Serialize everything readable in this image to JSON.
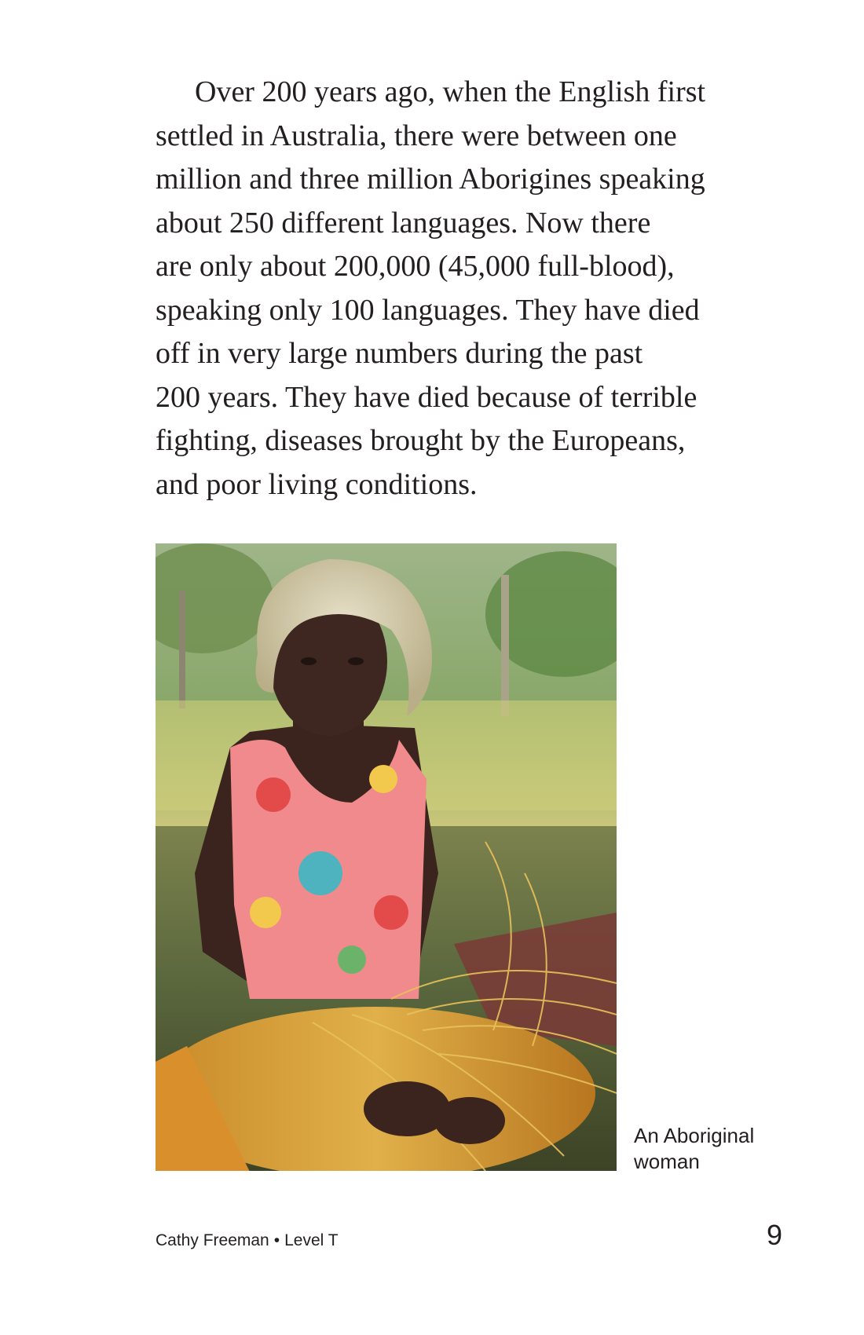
{
  "body_text": {
    "lines": [
      "Over 200 years ago, when the English first",
      "settled in Australia, there were between one",
      "million and three million Aborigines speaking",
      "about 250 different languages. Now there",
      "are only about 200,000 (45,000 full-blood),",
      "speaking only 100 languages. They have died",
      "off in very large numbers during the past",
      "200 years. They have died because of terrible",
      "fighting, diseases brought by the Europeans,",
      "and poor living conditions."
    ]
  },
  "photo": {
    "caption_lines": [
      "An Aboriginal",
      "woman"
    ]
  },
  "footer": {
    "book_title": "Cathy Freeman",
    "separator": "•",
    "level": "Level T",
    "page_number": "9"
  }
}
